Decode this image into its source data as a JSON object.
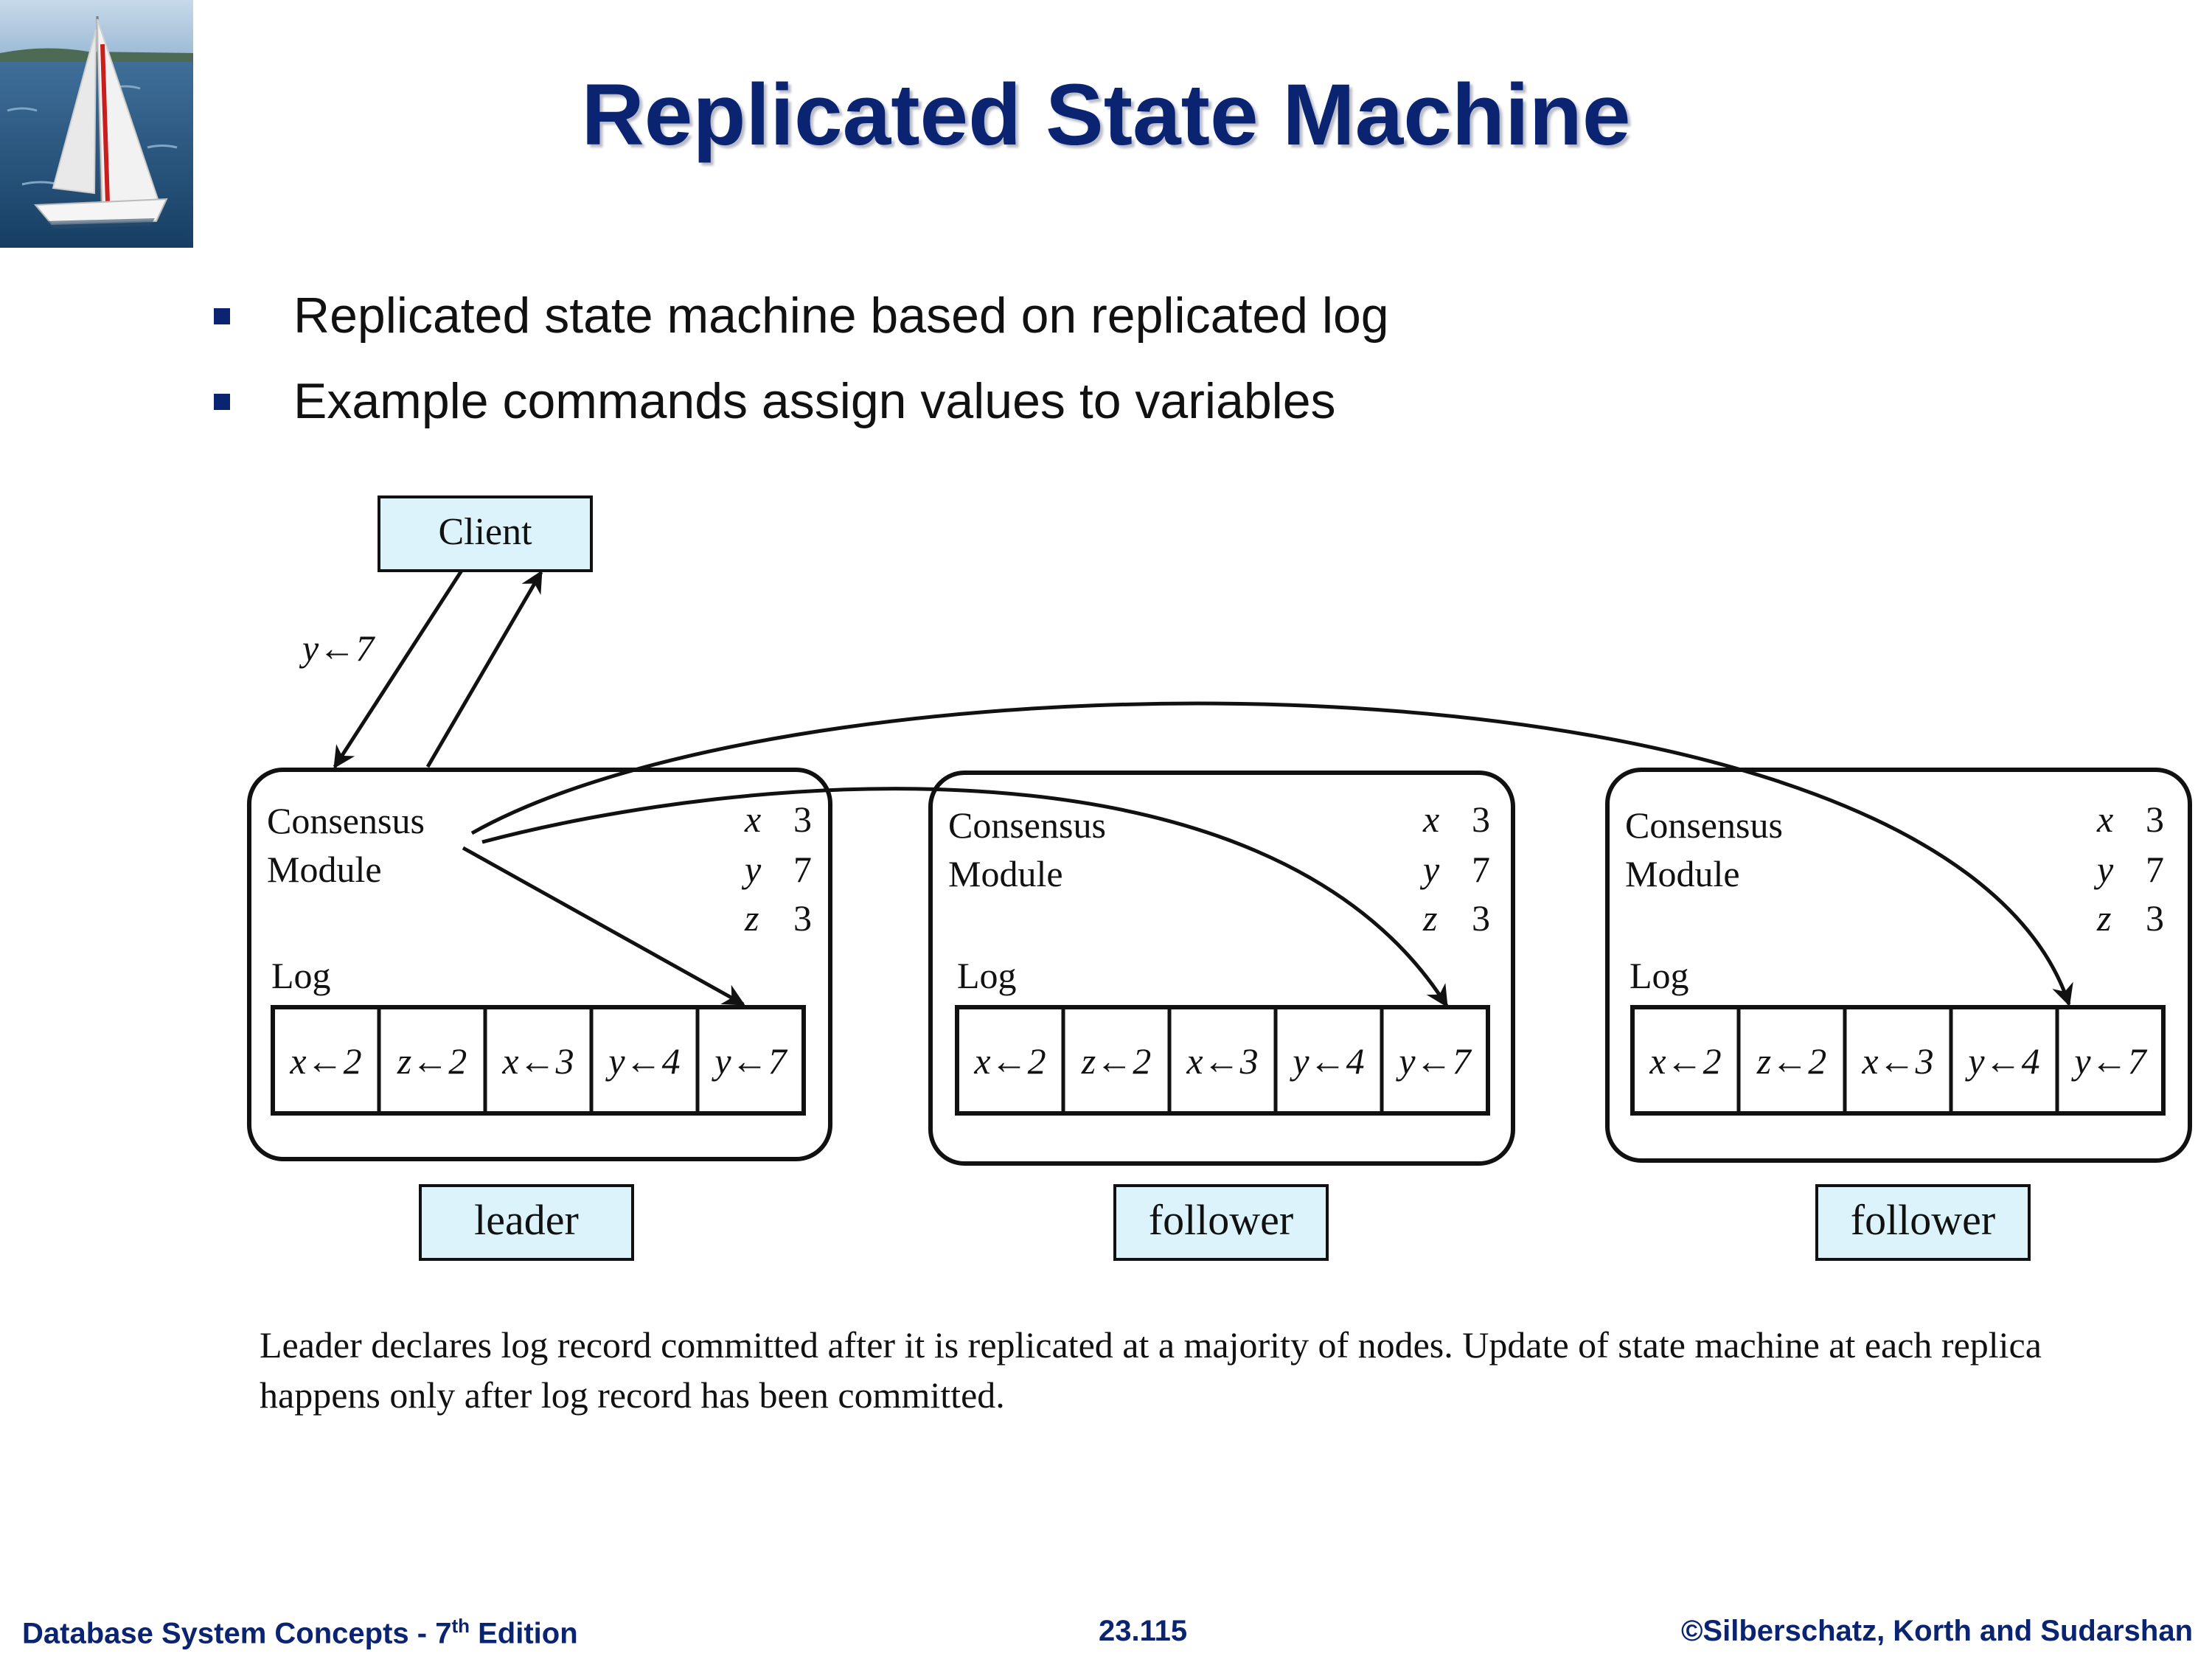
{
  "title": "Replicated State Machine",
  "bullets": [
    "Replicated state machine based on replicated log",
    "Example commands assign values to variables"
  ],
  "diagram": {
    "client_label": "Client",
    "request_label": "y←7",
    "nodes": [
      {
        "role": "leader",
        "module_line1": "Consensus",
        "module_line2": "Module",
        "log_label": "Log",
        "state": [
          {
            "var": "x",
            "val": "3"
          },
          {
            "var": "y",
            "val": "7"
          },
          {
            "var": "z",
            "val": "3"
          }
        ],
        "log": [
          "x←2",
          "z←2",
          "x←3",
          "y←4",
          "y←7"
        ]
      },
      {
        "role": "follower",
        "module_line1": "Consensus",
        "module_line2": "Module",
        "log_label": "Log",
        "state": [
          {
            "var": "x",
            "val": "3"
          },
          {
            "var": "y",
            "val": "7"
          },
          {
            "var": "z",
            "val": "3"
          }
        ],
        "log": [
          "x←2",
          "z←2",
          "x←3",
          "y←4",
          "y←7"
        ]
      },
      {
        "role": "follower",
        "module_line1": "Consensus",
        "module_line2": "Module",
        "log_label": "Log",
        "state": [
          {
            "var": "x",
            "val": "3"
          },
          {
            "var": "y",
            "val": "7"
          },
          {
            "var": "z",
            "val": "3"
          }
        ],
        "log": [
          "x←2",
          "z←2",
          "x←3",
          "y←4",
          "y←7"
        ]
      }
    ]
  },
  "caption": "Leader declares log record committed after it is replicated at a majority of nodes. Update of state machine at each replica happens only after log record has been committed.",
  "footer": {
    "left": "Database System Concepts - 7",
    "left_sup": "th",
    "left_tail": " Edition",
    "center": "23.115",
    "right": "©Silberschatz, Korth and Sudarshan"
  },
  "colors": {
    "title": "#0b2472",
    "label_box_fill": "#dcf3fb",
    "stroke": "#111111"
  }
}
